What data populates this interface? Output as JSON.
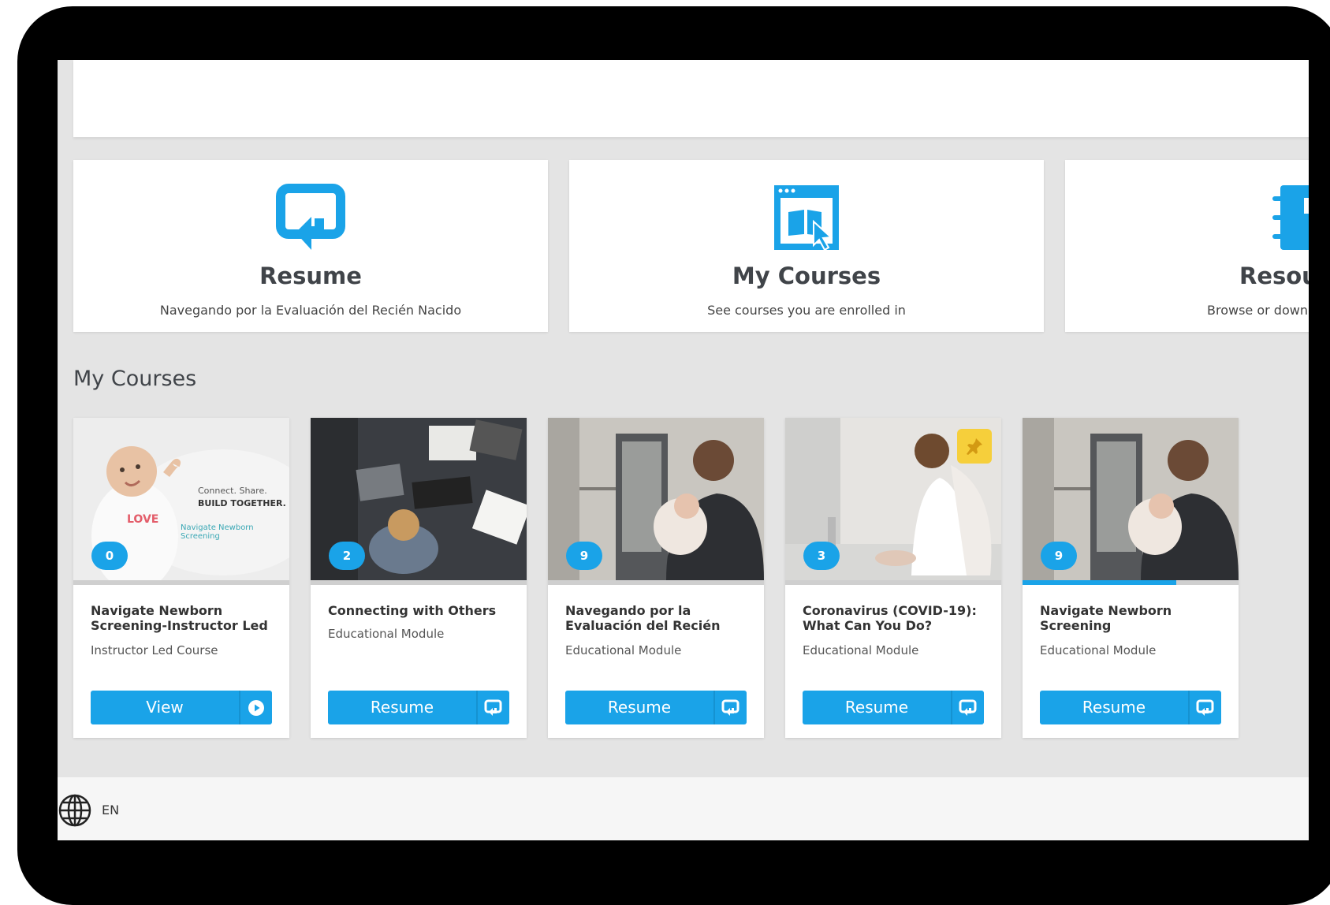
{
  "colors": {
    "accent": "#1aa3e8",
    "pin": "#f6cf3b",
    "panel": "#ffffff",
    "background": "#e4e4e4"
  },
  "tiles": [
    {
      "title": "Resume",
      "subtitle": "Navegando por la Evaluación del Recién Nacido",
      "icon": "resume-icon"
    },
    {
      "title": "My Courses",
      "subtitle": "See courses you are enrolled in",
      "icon": "course-book-icon"
    },
    {
      "title": "Resou",
      "subtitle": "Browse or downl",
      "icon": "resources-icon"
    }
  ],
  "section": {
    "title": "My Courses"
  },
  "thumb_texts": {
    "line1": "Connect. Share.",
    "line2": "BUILD TOGETHER.",
    "brand": "Navigate Newborn Screening",
    "shirt": "LOVE"
  },
  "courses": [
    {
      "title": "Navigate Newborn Screening-Instructor Led",
      "type": "Instructor Led Course",
      "count": "0",
      "button": "View",
      "button_icon": "play-circle-icon",
      "progress": 0
    },
    {
      "title": "Connecting with Others",
      "type": "Educational Module",
      "count": "2",
      "button": "Resume",
      "button_icon": "resume-icon",
      "progress": 0
    },
    {
      "title": "Navegando por la Evaluación del Recién",
      "type": "Educational Module",
      "count": "9",
      "button": "Resume",
      "button_icon": "resume-icon",
      "progress": 0
    },
    {
      "title": "Coronavirus (COVID-19): What Can You Do?",
      "type": "Educational Module",
      "count": "3",
      "button": "Resume",
      "button_icon": "resume-icon",
      "progress": 0,
      "pinned": true
    },
    {
      "title": "Navigate Newborn Screening",
      "type": "Educational Module",
      "count": "9",
      "button": "Resume",
      "button_icon": "resume-icon",
      "progress": 0.71
    }
  ],
  "footer": {
    "language": "EN",
    "icon": "globe-icon"
  }
}
